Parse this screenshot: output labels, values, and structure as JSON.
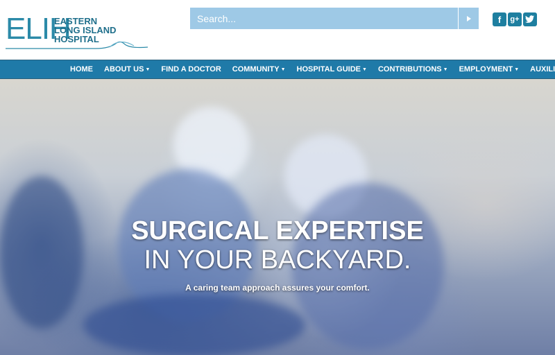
{
  "logo": {
    "mark": "ELIH",
    "line1": "EASTERN",
    "line2": "LONG ISLAND",
    "line3": "HOSPITAL"
  },
  "search": {
    "placeholder": "Search..."
  },
  "social": {
    "facebook": "f",
    "googleplus": "g+",
    "twitter": "t"
  },
  "nav": {
    "items": [
      {
        "label": "HOME",
        "dropdown": false
      },
      {
        "label": "ABOUT US",
        "dropdown": true
      },
      {
        "label": "FIND A DOCTOR",
        "dropdown": false
      },
      {
        "label": "COMMUNITY",
        "dropdown": true
      },
      {
        "label": "HOSPITAL GUIDE",
        "dropdown": true
      },
      {
        "label": "CONTRIBUTIONS",
        "dropdown": true
      },
      {
        "label": "EMPLOYMENT",
        "dropdown": true
      },
      {
        "label": "AUXILIARY",
        "dropdown": true
      }
    ]
  },
  "hero": {
    "headline1": "SURGICAL EXPERTISE",
    "headline2": "IN YOUR BACKYARD.",
    "tagline": "A caring team approach assures your comfort."
  },
  "colors": {
    "brand": "#2b8aa8",
    "nav_bg": "#1f7aa8",
    "search_bg": "#9ec9e6"
  },
  "icons": [
    "search-arrow-icon",
    "facebook-icon",
    "google-plus-icon",
    "twitter-icon",
    "caret-down-icon"
  ]
}
